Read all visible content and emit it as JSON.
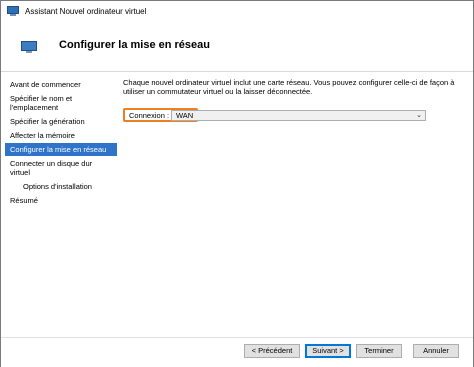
{
  "window": {
    "title": "Assistant Nouvel ordinateur virtuel"
  },
  "header": {
    "title": "Configurer la mise en réseau",
    "icon": "monitor-icon"
  },
  "nav": {
    "items": [
      {
        "label": "Avant de commencer"
      },
      {
        "label": "Spécifier le nom et l'emplacement"
      },
      {
        "label": "Spécifier la génération"
      },
      {
        "label": "Affecter la mémoire"
      },
      {
        "label": "Configurer la mise en réseau",
        "active": true
      },
      {
        "label": "Connecter un disque dur virtuel"
      },
      {
        "label": "Options d'installation",
        "sub": true
      },
      {
        "label": "Résumé"
      }
    ]
  },
  "content": {
    "description": "Chaque nouvel ordinateur virtuel inclut une carte réseau. Vous pouvez configurer celle-ci de façon à utiliser un commutateur virtuel ou la laisser déconnectée.",
    "connection_label": "Connexion :",
    "connection_value": "WAN",
    "highlight_color": "#ef7d22"
  },
  "footer": {
    "prev_label": "< Précédent",
    "next_label": "Suivant >",
    "finish_label": "Terminer",
    "cancel_label": "Annuler"
  },
  "colors": {
    "accent": "#2f74c9",
    "focus": "#0078d7"
  }
}
